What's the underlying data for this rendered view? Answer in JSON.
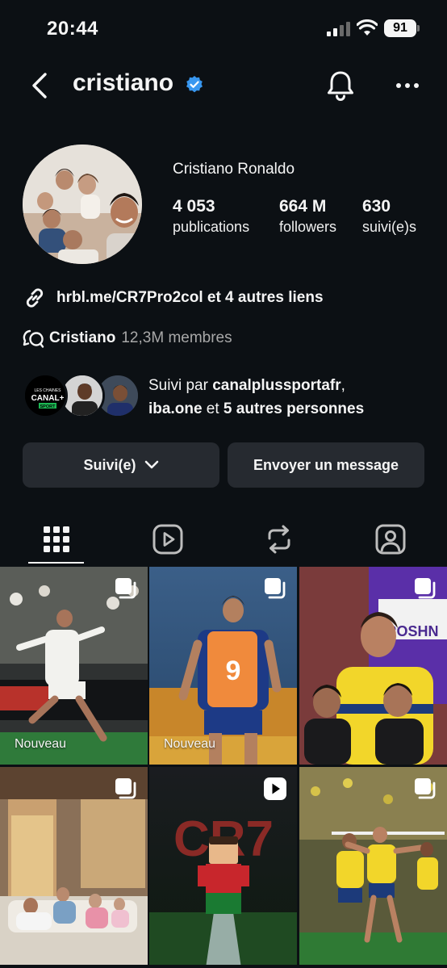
{
  "status_bar": {
    "time": "20:44",
    "battery": "91"
  },
  "header": {
    "username": "cristiano"
  },
  "profile": {
    "full_name": "Cristiano Ronaldo",
    "stats": [
      {
        "value": "4 053",
        "label": "publications"
      },
      {
        "value": "664 M",
        "label": "followers"
      },
      {
        "value": "630",
        "label": "suivi(e)s"
      }
    ],
    "link": "hrbl.me/CR7Pro2col et 4 autres liens",
    "community": {
      "name": "Cristiano",
      "members": "12,3M membres"
    },
    "followed_by": {
      "prefix": "Suivi par ",
      "user1": "canalplussportafr",
      "sep": ",",
      "user2": "iba.one",
      "middle": " et ",
      "others": "5 autres personnes"
    },
    "canal_logo": {
      "line1": "LES CHAINES",
      "line2": "CANAL+",
      "line3": "SPORT"
    }
  },
  "actions": {
    "following_label": "Suivi(e)",
    "message_label": "Envoyer un message"
  },
  "tabs": [
    "grid-icon",
    "reels-icon",
    "reposts-icon",
    "tagged-icon"
  ],
  "posts": [
    {
      "label": "Nouveau",
      "type": "carousel"
    },
    {
      "label": "Nouveau",
      "type": "carousel"
    },
    {
      "label": "",
      "type": "carousel"
    },
    {
      "label": "",
      "type": "carousel"
    },
    {
      "label": "",
      "type": "reel"
    },
    {
      "label": "",
      "type": "carousel"
    }
  ],
  "post_texts": {
    "jersey_number": "9",
    "sponsor": "ROSHN",
    "cr7": "CR7"
  },
  "colors": {
    "background": "#0c1014",
    "button": "#262a30",
    "verified": "#3897f0"
  }
}
